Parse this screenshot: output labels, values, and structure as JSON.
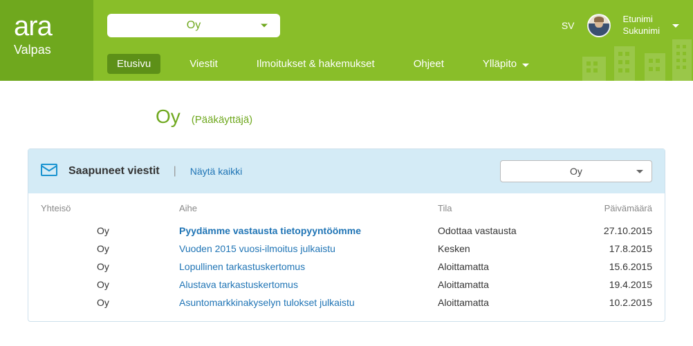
{
  "logo": {
    "main": "ara",
    "sub": "Valpas"
  },
  "header": {
    "company_select": "Oy",
    "lang_switch": "SV",
    "user": {
      "firstname": "Etunimi",
      "lastname": "Sukunimi"
    }
  },
  "nav": {
    "items": [
      {
        "label": "Etusivu",
        "active": true
      },
      {
        "label": "Viestit"
      },
      {
        "label": "Ilmoitukset & hakemukset"
      },
      {
        "label": "Ohjeet"
      },
      {
        "label": "Ylläpito",
        "dropdown": true
      }
    ]
  },
  "page": {
    "title": "Oy",
    "role": "(Pääkäyttäjä)"
  },
  "inbox": {
    "title": "Saapuneet viestit",
    "show_all": "Näytä kaikki",
    "filter_value": "Oy",
    "columns": {
      "company": "Yhteisö",
      "subject": "Aihe",
      "status": "Tila",
      "date": "Päivämäärä"
    },
    "rows": [
      {
        "company": "Oy",
        "subject": "Pyydämme vastausta tietopyyntöömme",
        "status": "Odottaa vastausta",
        "date": "27.10.2015",
        "bold": true
      },
      {
        "company": "Oy",
        "subject": "Vuoden 2015 vuosi-ilmoitus julkaistu",
        "status": "Kesken",
        "date": "17.8.2015"
      },
      {
        "company": "Oy",
        "subject": "Lopullinen tarkastuskertomus",
        "status": "Aloittamatta",
        "date": "15.6.2015"
      },
      {
        "company": "Oy",
        "subject": "Alustava tarkastuskertomus",
        "status": "Aloittamatta",
        "date": "19.4.2015"
      },
      {
        "company": "Oy",
        "subject": "Asuntomarkkinakyselyn tulokset julkaistu",
        "status": "Aloittamatta",
        "date": "10.2.2015"
      }
    ]
  }
}
